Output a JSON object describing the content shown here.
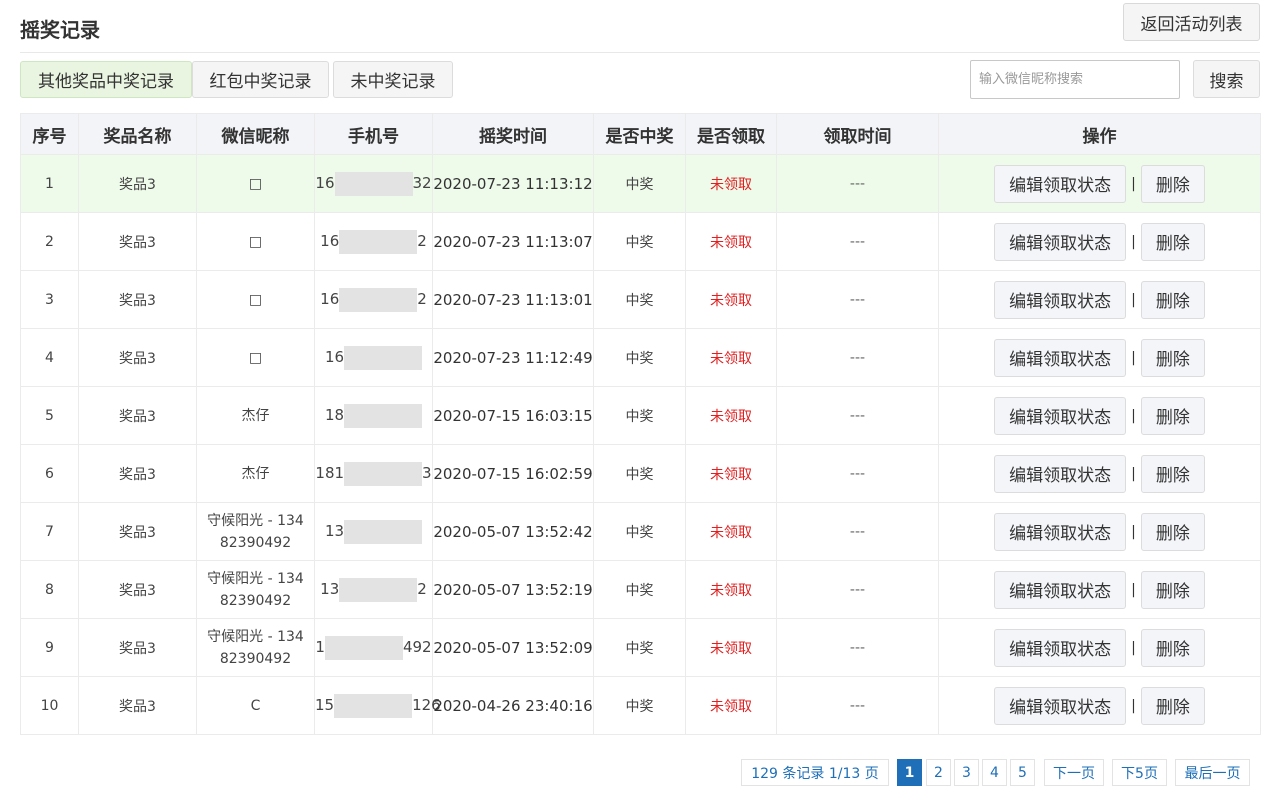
{
  "page": {
    "title": "摇奖记录",
    "back_label": "返回活动列表"
  },
  "tabs": [
    {
      "label": "其他奖品中奖记录"
    },
    {
      "label": "红包中奖记录"
    },
    {
      "label": "未中奖记录"
    }
  ],
  "search": {
    "placeholder": "输入微信昵称搜索",
    "value": "",
    "button_label": "搜索"
  },
  "table": {
    "headers": [
      "序号",
      "奖品名称",
      "微信昵称",
      "手机号",
      "摇奖时间",
      "是否中奖",
      "是否领取",
      "领取时间",
      "操作"
    ],
    "edit_label": "编辑领取状态",
    "separator": "|",
    "delete_label": "删除",
    "rows": [
      {
        "no": "1",
        "prize": "奖品3",
        "nick": "□",
        "nick2": "",
        "phone_start": "16",
        "phone_end": "32",
        "time": "2020-07-23 11:13:12",
        "won": "中奖",
        "claimed": "未领取",
        "claim_time": "---"
      },
      {
        "no": "2",
        "prize": "奖品3",
        "nick": "□",
        "nick2": "",
        "phone_start": "16",
        "phone_end": "2",
        "time": "2020-07-23 11:13:07",
        "won": "中奖",
        "claimed": "未领取",
        "claim_time": "---"
      },
      {
        "no": "3",
        "prize": "奖品3",
        "nick": "□",
        "nick2": "",
        "phone_start": "16",
        "phone_end": "2",
        "time": "2020-07-23 11:13:01",
        "won": "中奖",
        "claimed": "未领取",
        "claim_time": "---"
      },
      {
        "no": "4",
        "prize": "奖品3",
        "nick": "□",
        "nick2": "",
        "phone_start": "16",
        "phone_end": "",
        "time": "2020-07-23 11:12:49",
        "won": "中奖",
        "claimed": "未领取",
        "claim_time": "---"
      },
      {
        "no": "5",
        "prize": "奖品3",
        "nick": "杰仔",
        "nick2": "",
        "phone_start": "18",
        "phone_end": "",
        "time": "2020-07-15 16:03:15",
        "won": "中奖",
        "claimed": "未领取",
        "claim_time": "---"
      },
      {
        "no": "6",
        "prize": "奖品3",
        "nick": "杰仔",
        "nick2": "",
        "phone_start": "181",
        "phone_end": "3",
        "time": "2020-07-15 16:02:59",
        "won": "中奖",
        "claimed": "未领取",
        "claim_time": "---"
      },
      {
        "no": "7",
        "prize": "奖品3",
        "nick": "守候阳光 - 134",
        "nick2": "82390492",
        "phone_start": "13",
        "phone_end": "",
        "time": "2020-05-07 13:52:42",
        "won": "中奖",
        "claimed": "未领取",
        "claim_time": "---"
      },
      {
        "no": "8",
        "prize": "奖品3",
        "nick": "守候阳光 - 134",
        "nick2": "82390492",
        "phone_start": "13",
        "phone_end": "2",
        "time": "2020-05-07 13:52:19",
        "won": "中奖",
        "claimed": "未领取",
        "claim_time": "---"
      },
      {
        "no": "9",
        "prize": "奖品3",
        "nick": "守候阳光 - 134",
        "nick2": "82390492",
        "phone_start": "1",
        "phone_end": "492",
        "time": "2020-05-07 13:52:09",
        "won": "中奖",
        "claimed": "未领取",
        "claim_time": "---"
      },
      {
        "no": "10",
        "prize": "奖品3",
        "nick": "C",
        "nick2": "",
        "phone_start": "15",
        "phone_end": "126",
        "time": "2020-04-26 23:40:16",
        "won": "中奖",
        "claimed": "未领取",
        "claim_time": "---"
      }
    ]
  },
  "pagination": {
    "summary": "129 条记录 1/13 页",
    "pages": [
      "1",
      "2",
      "3",
      "4",
      "5"
    ],
    "current": "1",
    "next": "下一页",
    "next5": "下5页",
    "last": "最后一页"
  },
  "colors": {
    "accent": "#1e6fb8",
    "unclaimed": "#e02020",
    "highlight_row": "#eefaea"
  }
}
